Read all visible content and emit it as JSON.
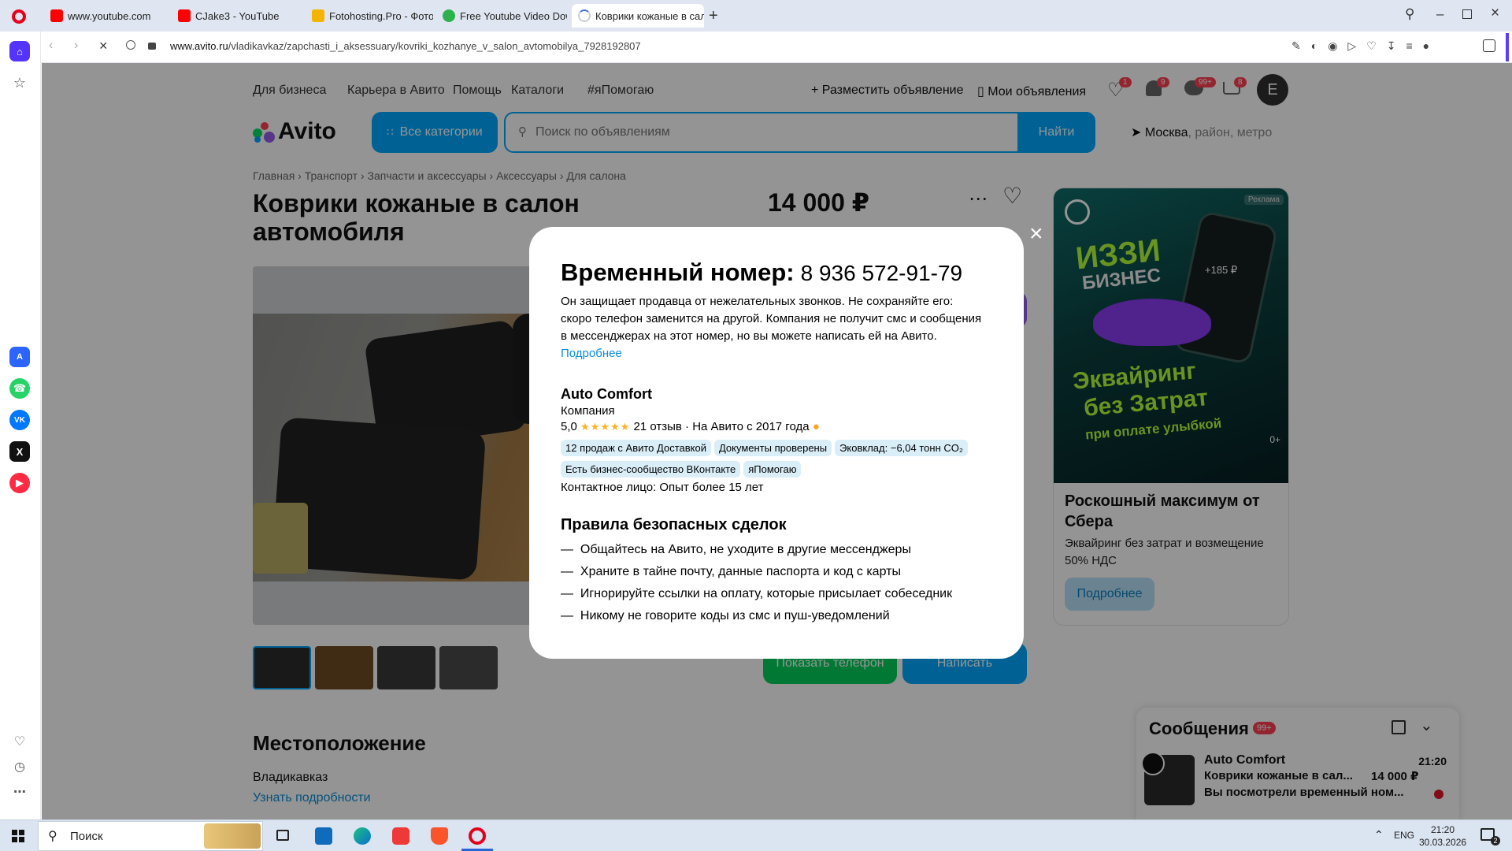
{
  "browser": {
    "tabs": [
      {
        "label": "www.youtube.com",
        "favicon": "youtube"
      },
      {
        "label": "CJake3 - YouTube",
        "favicon": "youtube"
      },
      {
        "label": "Fotohosting.Pro - Фотохо",
        "favicon": "fotohosting"
      },
      {
        "label": "Free Youtube Video Down",
        "favicon": "downloader"
      },
      {
        "label": "Коврики кожаные в сало",
        "favicon": "loading"
      }
    ],
    "url_domain": "www.avito.ru",
    "url_path": "/vladikavkaz/zapchasti_i_aksessuary/kovriki_kozhanye_v_salon_avtomobilya_7928192807"
  },
  "avito": {
    "top_nav": [
      "Для бизнеса",
      "Карьера в Авито",
      "Помощь",
      "Каталоги",
      "#яПомогаю"
    ],
    "post_ad": "Разместить объявление",
    "my_ads": "Мои объявления",
    "counters": {
      "favorites": "1",
      "notifications": "9",
      "messages": "99+",
      "cart": "8"
    },
    "avatar_letter": "E",
    "logo": "Avito",
    "all_categories": "Все категории",
    "search_placeholder": "Поиск по объявлениям",
    "search_button": "Найти",
    "location_city": "Москва",
    "location_rest": ", район, метро",
    "breadcrumbs": [
      "Главная",
      "Транспорт",
      "Запчасти и аксессуары",
      "Аксессуары",
      "Для салона"
    ],
    "item_title_line1": "Коврики кожаные в салон",
    "item_title_line2": "автомобиля",
    "price": "14 000 ₽",
    "show_phone": "Показать телефон",
    "write": "Написать",
    "location_heading": "Местоположение",
    "location_value": "Владикавказ",
    "location_more": "Узнать подробности",
    "ad": {
      "label": "Реклама",
      "brand_line1": "ИЗЗИ",
      "brand_line2": "БИЗНЕС",
      "price_tag": "+185 ₽",
      "slogan1": "Эквайринг",
      "slogan2": "без Затрат",
      "slogan3": "при оплате улыбкой",
      "age": "0+",
      "title": "Роскошный максимум от Сбера",
      "text": "Эквайринг без затрат и возмещение 50% НДС",
      "button": "Подробнее"
    },
    "messenger": {
      "title": "Сообщения",
      "badge": "99+",
      "sender": "Auto Comfort",
      "time": "21:20",
      "item": "Коврики кожаные в сал...",
      "price": "14 000 ₽",
      "preview": "Вы посмотрели временный ном..."
    }
  },
  "modal": {
    "title": "Временный номер:",
    "phone": "8 936 572-91-79",
    "text": "Он защищает продавца от нежелательных звонков. Не сохраняйте его: скоро телефон заменится на другой. Компания не получит смс и сообщения в мессенджерах на этот номер, но вы можете написать ей на Авито.",
    "more": "Подробнее",
    "seller": "Auto Comfort",
    "seller_type": "Компания",
    "rating": "5,0",
    "reviews": "21 отзыв",
    "since": "· На Авито с 2017 года",
    "badges": [
      "12 продаж с Авито Доставкой",
      "Документы проверены",
      "Эковклад: −6,04 тонн CO₂",
      "Есть бизнес-сообщество ВКонтакте",
      "яПомогаю"
    ],
    "contact": "Контактное лицо: Опыт более 15 лет",
    "rules_title": "Правила безопасных сделок",
    "rules": [
      "Общайтесь на Авито, не уходите в другие мессенджеры",
      "Храните в тайне почту, данные паспорта и код с карты",
      "Игнорируйте ссылки на оплату, которые присылает собеседник",
      "Никому не говорите коды из смс и пуш-уведомлений"
    ]
  },
  "taskbar": {
    "search": "Поиск",
    "lang": "ENG",
    "time": "21:20",
    "date": "30.03.2026",
    "notif": "2"
  }
}
